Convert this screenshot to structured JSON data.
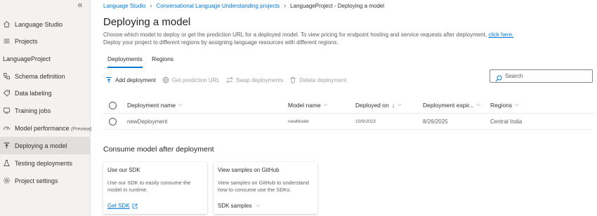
{
  "sidebar": {
    "collapse_glyph": "«",
    "project_heading": "LanguageProject",
    "items": [
      {
        "label": "Language Studio",
        "icon": "home-icon"
      },
      {
        "label": "Projects",
        "icon": "list-icon"
      },
      {
        "label": "Schema definition",
        "icon": "schema-icon"
      },
      {
        "label": "Data labeling",
        "icon": "tag-icon"
      },
      {
        "label": "Training jobs",
        "icon": "training-icon"
      },
      {
        "label": "Model performance",
        "sub": "(Preview)",
        "icon": "gauge-icon"
      },
      {
        "label": "Deploying a model",
        "icon": "deploy-icon",
        "active": true
      },
      {
        "label": "Testing deployments",
        "icon": "flask-icon"
      },
      {
        "label": "Project settings",
        "icon": "gear-icon"
      }
    ]
  },
  "breadcrumb": {
    "items": [
      "Language Studio",
      "Conversational Language Understanding projects"
    ],
    "current": "LanguageProject - Deploying a model"
  },
  "page": {
    "title": "Deploying a model",
    "desc_line1": "Choose which model to deploy or get the prediction URL for a deployed model. To view pricing for endpoint hosting and service requests after deployment, ",
    "desc_link": "click here.",
    "desc_line2": "Deploy your project to different regions by assigning language resources with different regions."
  },
  "tabs": [
    "Deployments",
    "Regions"
  ],
  "commands": {
    "add": "Add deployment",
    "predict": "Get prediction URL",
    "swap": "Swap deployments",
    "delete": "Delete deployment"
  },
  "search": {
    "placeholder": "Search"
  },
  "table": {
    "headers": {
      "name": "Deployment name",
      "model": "Model name",
      "deployed": "Deployed on",
      "expiry": "Deployment expir...",
      "regions": "Regions"
    },
    "rows": [
      {
        "name": "newDeployment",
        "model": "newModel",
        "deployed": "10/9/2023",
        "expiry": "8/26/2025",
        "regions": "Central India"
      }
    ]
  },
  "consume": {
    "heading": "Consume model after deployment",
    "cards": [
      {
        "title": "Use our SDK",
        "desc": "Use our SDK to easily consume the model in runtime.",
        "action": "Get SDK"
      },
      {
        "title": "View samples on GitHub",
        "desc": "View samples on GitHub to understand how to consume use the SDKs.",
        "action": "SDK samples"
      }
    ]
  },
  "colors": {
    "accent": "#0078d4",
    "sidebar_bg": "#f3f2f1",
    "active_bg": "#e1dfdd"
  }
}
